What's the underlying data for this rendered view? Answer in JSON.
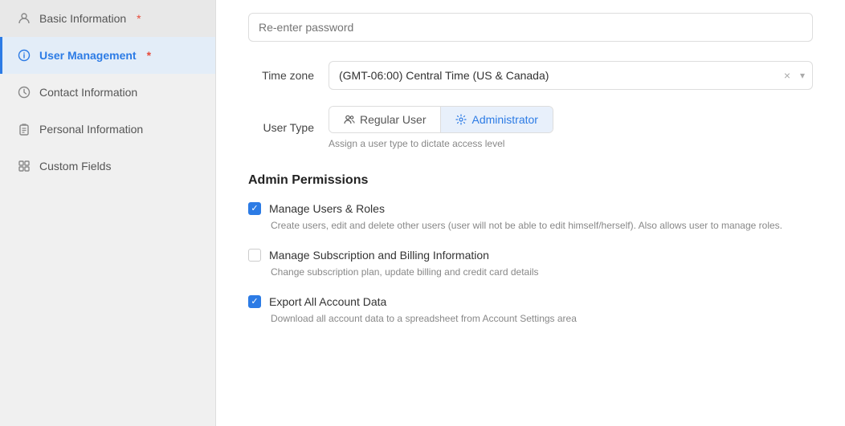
{
  "sidebar": {
    "items": [
      {
        "id": "basic-information",
        "label": "Basic Information",
        "icon": "person-icon",
        "active": false,
        "required": true
      },
      {
        "id": "user-management",
        "label": "User Management",
        "icon": "info-circle-icon",
        "active": true,
        "required": true
      },
      {
        "id": "contact-information",
        "label": "Contact Information",
        "icon": "clock-icon",
        "active": false,
        "required": false
      },
      {
        "id": "personal-information",
        "label": "Personal Information",
        "icon": "clipboard-icon",
        "active": false,
        "required": false
      },
      {
        "id": "custom-fields",
        "label": "Custom Fields",
        "icon": "grid-icon",
        "active": false,
        "required": false
      }
    ]
  },
  "main": {
    "password_placeholder": "Re-enter password",
    "timezone_label": "Time zone",
    "timezone_value": "(GMT-06:00) Central Time (US & Canada)",
    "usertype_label": "User Type",
    "usertype_regular": "Regular User",
    "usertype_admin": "Administrator",
    "usertype_hint": "Assign a user type to dictate access level",
    "admin_permissions_title": "Admin Permissions",
    "permissions": [
      {
        "id": "manage-users-roles",
        "label": "Manage Users & Roles",
        "description": "Create users, edit and delete other users (user will not be able to edit himself/herself). Also allows user to manage roles.",
        "checked": true
      },
      {
        "id": "manage-subscription-billing",
        "label": "Manage Subscription and Billing Information",
        "description": "Change subscription plan, update billing and credit card details",
        "checked": false
      },
      {
        "id": "export-all-account-data",
        "label": "Export All Account Data",
        "description": "Download all account data to a spreadsheet from Account Settings area",
        "checked": true
      }
    ]
  },
  "colors": {
    "accent": "#2c7be5",
    "required": "#e74c3c"
  }
}
